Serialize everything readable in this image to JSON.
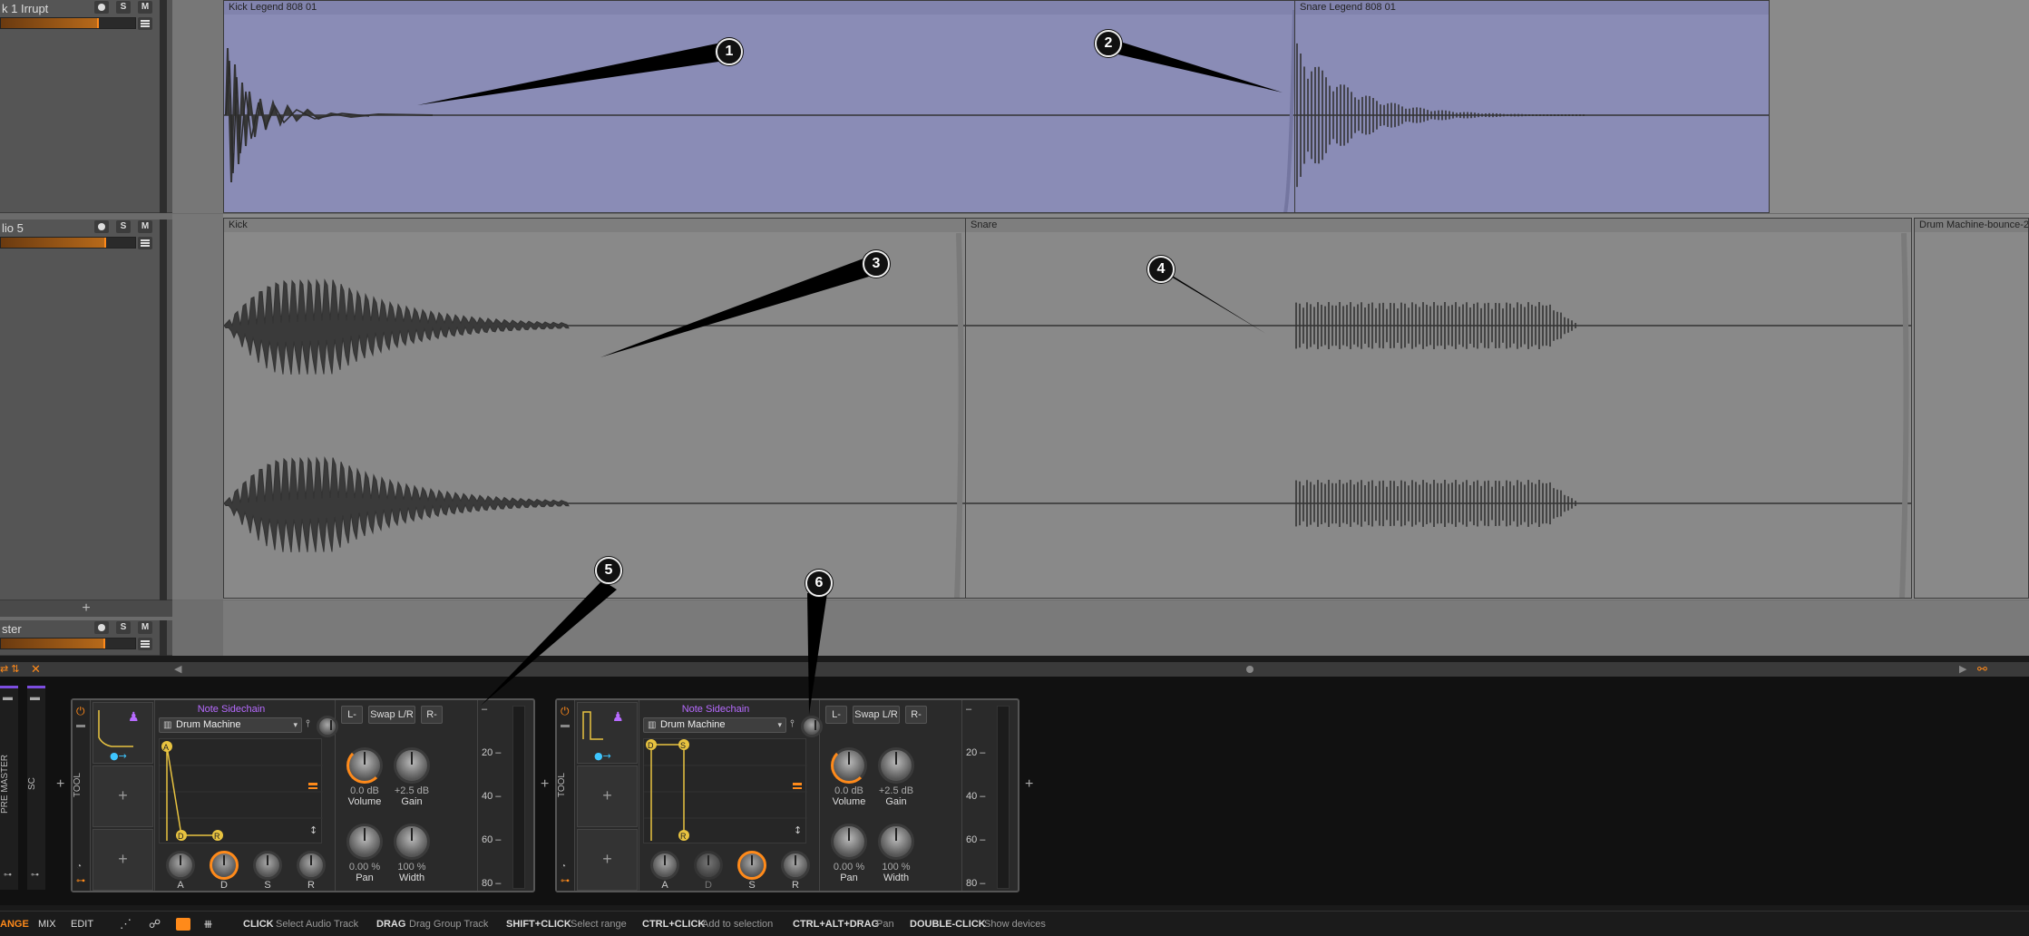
{
  "tracks": [
    {
      "name": "k 1 Irrupt",
      "mute": "M",
      "solo": "S"
    },
    {
      "name": "lio 5",
      "mute": "M",
      "solo": "S"
    },
    {
      "name": "ster",
      "mute": "M",
      "solo": "S"
    }
  ],
  "add_track": "+",
  "clips": {
    "kick_legend": "Kick Legend 808 01",
    "snare_legend": "Snare Legend 808 01",
    "kick": "Kick",
    "snare": "Snare",
    "bounce": "Drum Machine-bounce-2"
  },
  "callouts": [
    "1",
    "2",
    "3",
    "4",
    "5",
    "6"
  ],
  "side_tabs": {
    "pre_master": "PRE MASTER",
    "sc": "SC"
  },
  "devices": [
    {
      "tool": "TOOL",
      "title": "Note Sidechain",
      "source": "Drum Machine",
      "adsr": [
        "A",
        "D",
        "S",
        "R"
      ],
      "env_points": [
        "A",
        "D",
        "R"
      ],
      "active_knob": "D",
      "buttons": [
        "L-",
        "Swap L/R",
        "R-"
      ],
      "volume": {
        "value": "0.0 dB",
        "label": "Volume"
      },
      "gain": {
        "value": "+2.5 dB",
        "label": "Gain"
      },
      "pan": {
        "value": "0.00 %",
        "label": "Pan"
      },
      "width": {
        "value": "100 %",
        "label": "Width"
      },
      "scale": [
        "–",
        "20 –",
        "40 –",
        "60 –",
        "80 –"
      ]
    },
    {
      "tool": "TOOL",
      "title": "Note Sidechain",
      "source": "Drum Machine",
      "adsr": [
        "A",
        "D",
        "S",
        "R"
      ],
      "env_points": [
        "D",
        "S",
        "R"
      ],
      "active_knob": "S",
      "buttons": [
        "L-",
        "Swap L/R",
        "R-"
      ],
      "volume": {
        "value": "0.0 dB",
        "label": "Volume"
      },
      "gain": {
        "value": "+2.5 dB",
        "label": "Gain"
      },
      "pan": {
        "value": "0.00 %",
        "label": "Pan"
      },
      "width": {
        "value": "100 %",
        "label": "Width"
      },
      "scale": [
        "–",
        "20 –",
        "40 –",
        "60 –",
        "80 –"
      ]
    }
  ],
  "statusbar": {
    "modes": [
      "ANGE",
      "MIX",
      "EDIT"
    ],
    "hints": [
      {
        "key": "CLICK",
        "desc": "Select Audio Track"
      },
      {
        "key": "DRAG",
        "desc": "Drag Group Track"
      },
      {
        "key": "SHIFT+CLICK",
        "desc": "Select range"
      },
      {
        "key": "CTRL+CLICK",
        "desc": "Add to selection"
      },
      {
        "key": "CTRL+ALT+DRAG",
        "desc": "Pan"
      },
      {
        "key": "DOUBLE-CLICK",
        "desc": "Show devices"
      }
    ]
  },
  "colors": {
    "accent": "#ff8a1a",
    "purple": "#b76bff",
    "envelope": "#e8c340"
  }
}
